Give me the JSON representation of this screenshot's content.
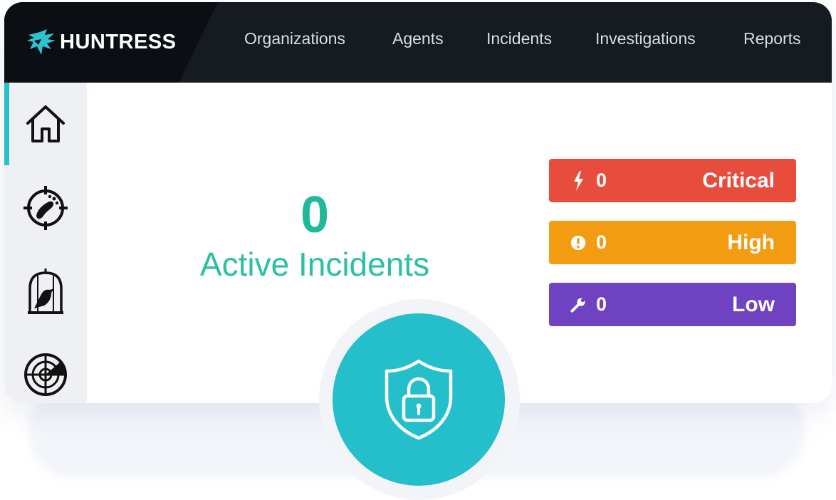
{
  "brand": {
    "name": "HUNTRESS",
    "logo_icon": "huntress-bird-icon"
  },
  "nav": {
    "items": [
      {
        "label": "Organizations"
      },
      {
        "label": "Agents"
      },
      {
        "label": "Incidents"
      },
      {
        "label": "Investigations"
      },
      {
        "label": "Reports"
      }
    ]
  },
  "sidebar": {
    "items": [
      {
        "icon": "home-icon",
        "active": true
      },
      {
        "icon": "footprint-target-icon",
        "active": false
      },
      {
        "icon": "bird-cage-icon",
        "active": false
      },
      {
        "icon": "radar-icon",
        "active": false
      }
    ]
  },
  "summary": {
    "count": "0",
    "label": "Active Incidents"
  },
  "severity": [
    {
      "icon": "lightning-icon",
      "count": "0",
      "label": "Critical",
      "color": "#e84c3d"
    },
    {
      "icon": "exclamation-circle-icon",
      "count": "0",
      "label": "High",
      "color": "#f39c12"
    },
    {
      "icon": "wrench-icon",
      "count": "0",
      "label": "Low",
      "color": "#6f42c1"
    }
  ],
  "accent": "#26c0cc",
  "badge": {
    "icon": "shield-lock-icon"
  }
}
